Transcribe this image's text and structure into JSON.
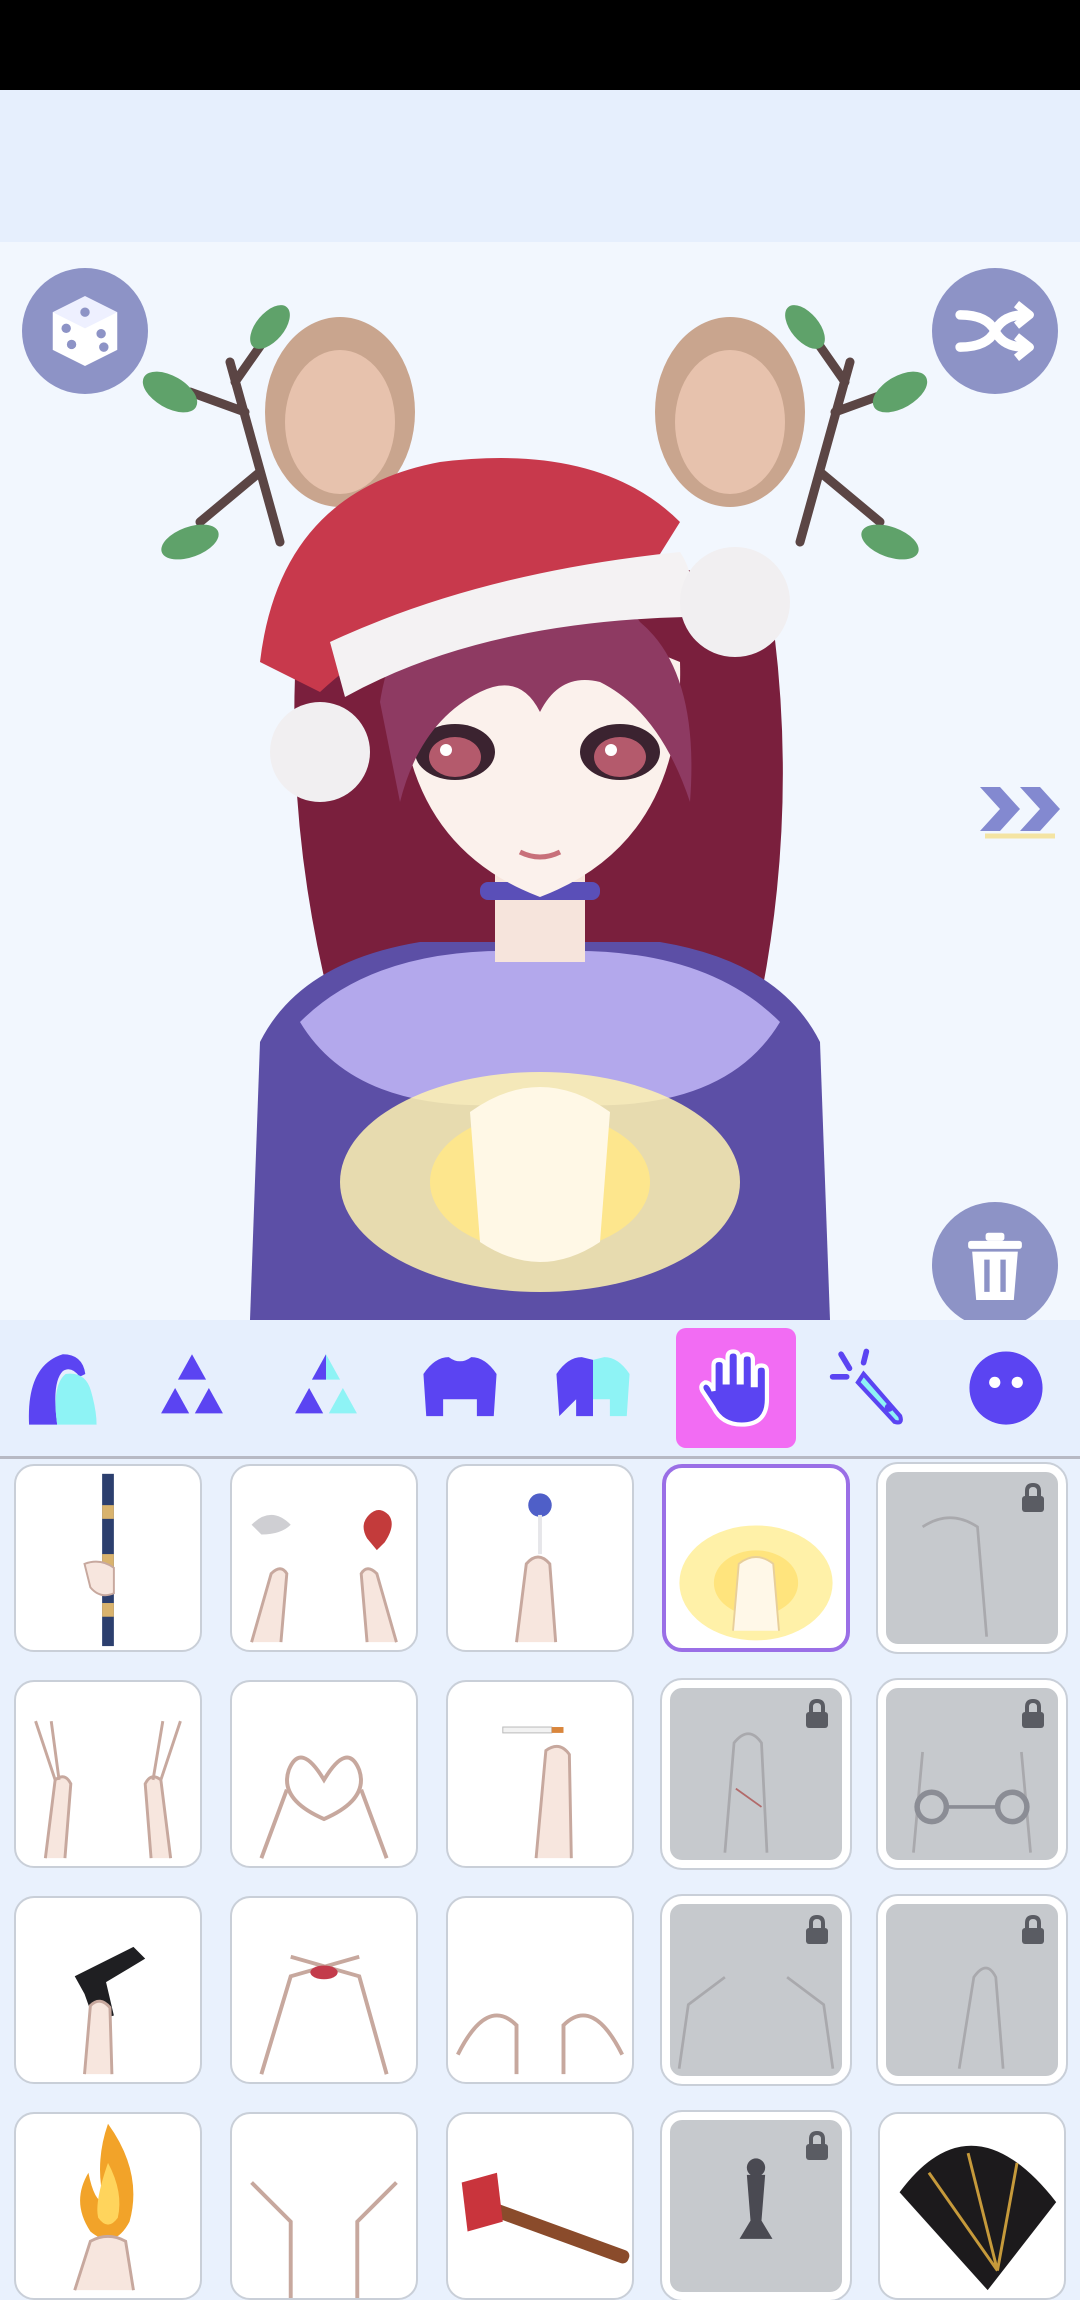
{
  "app": {
    "colors": {
      "accent": "#5b44f2",
      "active_tab": "#f26cf3",
      "round_button": "#8d93c6",
      "selected_border": "#9a6fe6",
      "locked_cell": "#c6c9cd"
    }
  },
  "toolbar": {
    "random_icon": "dice-icon",
    "shuffle_icon": "shuffle-icon",
    "delete_icon": "trash-icon",
    "next_icon": "double-chevron-right-icon"
  },
  "tabs": [
    {
      "name": "hair-back",
      "icon": "hair-icon",
      "active": false
    },
    {
      "name": "eyes",
      "icon": "triangle-cluster-icon",
      "active": false
    },
    {
      "name": "eyes-color",
      "icon": "triangle-cluster-color-icon",
      "active": false
    },
    {
      "name": "top",
      "icon": "shirt-icon",
      "active": false
    },
    {
      "name": "outfit-color",
      "icon": "shirt-color-icon",
      "active": false
    },
    {
      "name": "hands",
      "icon": "hand-icon",
      "active": true
    },
    {
      "name": "magic",
      "icon": "magic-wand-icon",
      "active": false
    },
    {
      "name": "face",
      "icon": "face-icon",
      "active": false
    }
  ],
  "items": [
    {
      "id": "staff",
      "icon": "staff-icon",
      "locked": false,
      "selected": false
    },
    {
      "id": "feather-heart",
      "icon": "feather-heart-icon",
      "locked": false,
      "selected": false
    },
    {
      "id": "lollipop",
      "icon": "lollipop-icon",
      "locked": false,
      "selected": false
    },
    {
      "id": "glowing-hands",
      "icon": "glow-hands-icon",
      "locked": false,
      "selected": true
    },
    {
      "id": "reaching-hand",
      "icon": "hand-icon",
      "locked": true,
      "selected": false
    },
    {
      "id": "peace-signs",
      "icon": "peace-sign-icon",
      "locked": false,
      "selected": false
    },
    {
      "id": "heart-hands",
      "icon": "heart-hands-icon",
      "locked": false,
      "selected": false
    },
    {
      "id": "cigarette",
      "icon": "cigarette-icon",
      "locked": false,
      "selected": false
    },
    {
      "id": "string-hand",
      "icon": "string-hand-icon",
      "locked": true,
      "selected": false
    },
    {
      "id": "handcuffs",
      "icon": "handcuffs-icon",
      "locked": true,
      "selected": false
    },
    {
      "id": "pistol",
      "icon": "pistol-icon",
      "locked": false,
      "selected": false
    },
    {
      "id": "lip-hands",
      "icon": "lips-hands-icon",
      "locked": false,
      "selected": false
    },
    {
      "id": "open-hands",
      "icon": "open-hands-icon",
      "locked": false,
      "selected": false
    },
    {
      "id": "pointing-hands",
      "icon": "pointing-hands-icon",
      "locked": true,
      "selected": false
    },
    {
      "id": "pinch-hand",
      "icon": "pinch-hand-icon",
      "locked": true,
      "selected": false
    },
    {
      "id": "fire",
      "icon": "fire-icon",
      "locked": false,
      "selected": false
    },
    {
      "id": "raised-hands",
      "icon": "raised-hands-icon",
      "locked": false,
      "selected": false
    },
    {
      "id": "axe",
      "icon": "axe-icon",
      "locked": false,
      "selected": false
    },
    {
      "id": "chess-piece",
      "icon": "chess-icon",
      "locked": true,
      "selected": false
    },
    {
      "id": "fan",
      "icon": "fan-icon",
      "locked": false,
      "selected": false
    }
  ]
}
